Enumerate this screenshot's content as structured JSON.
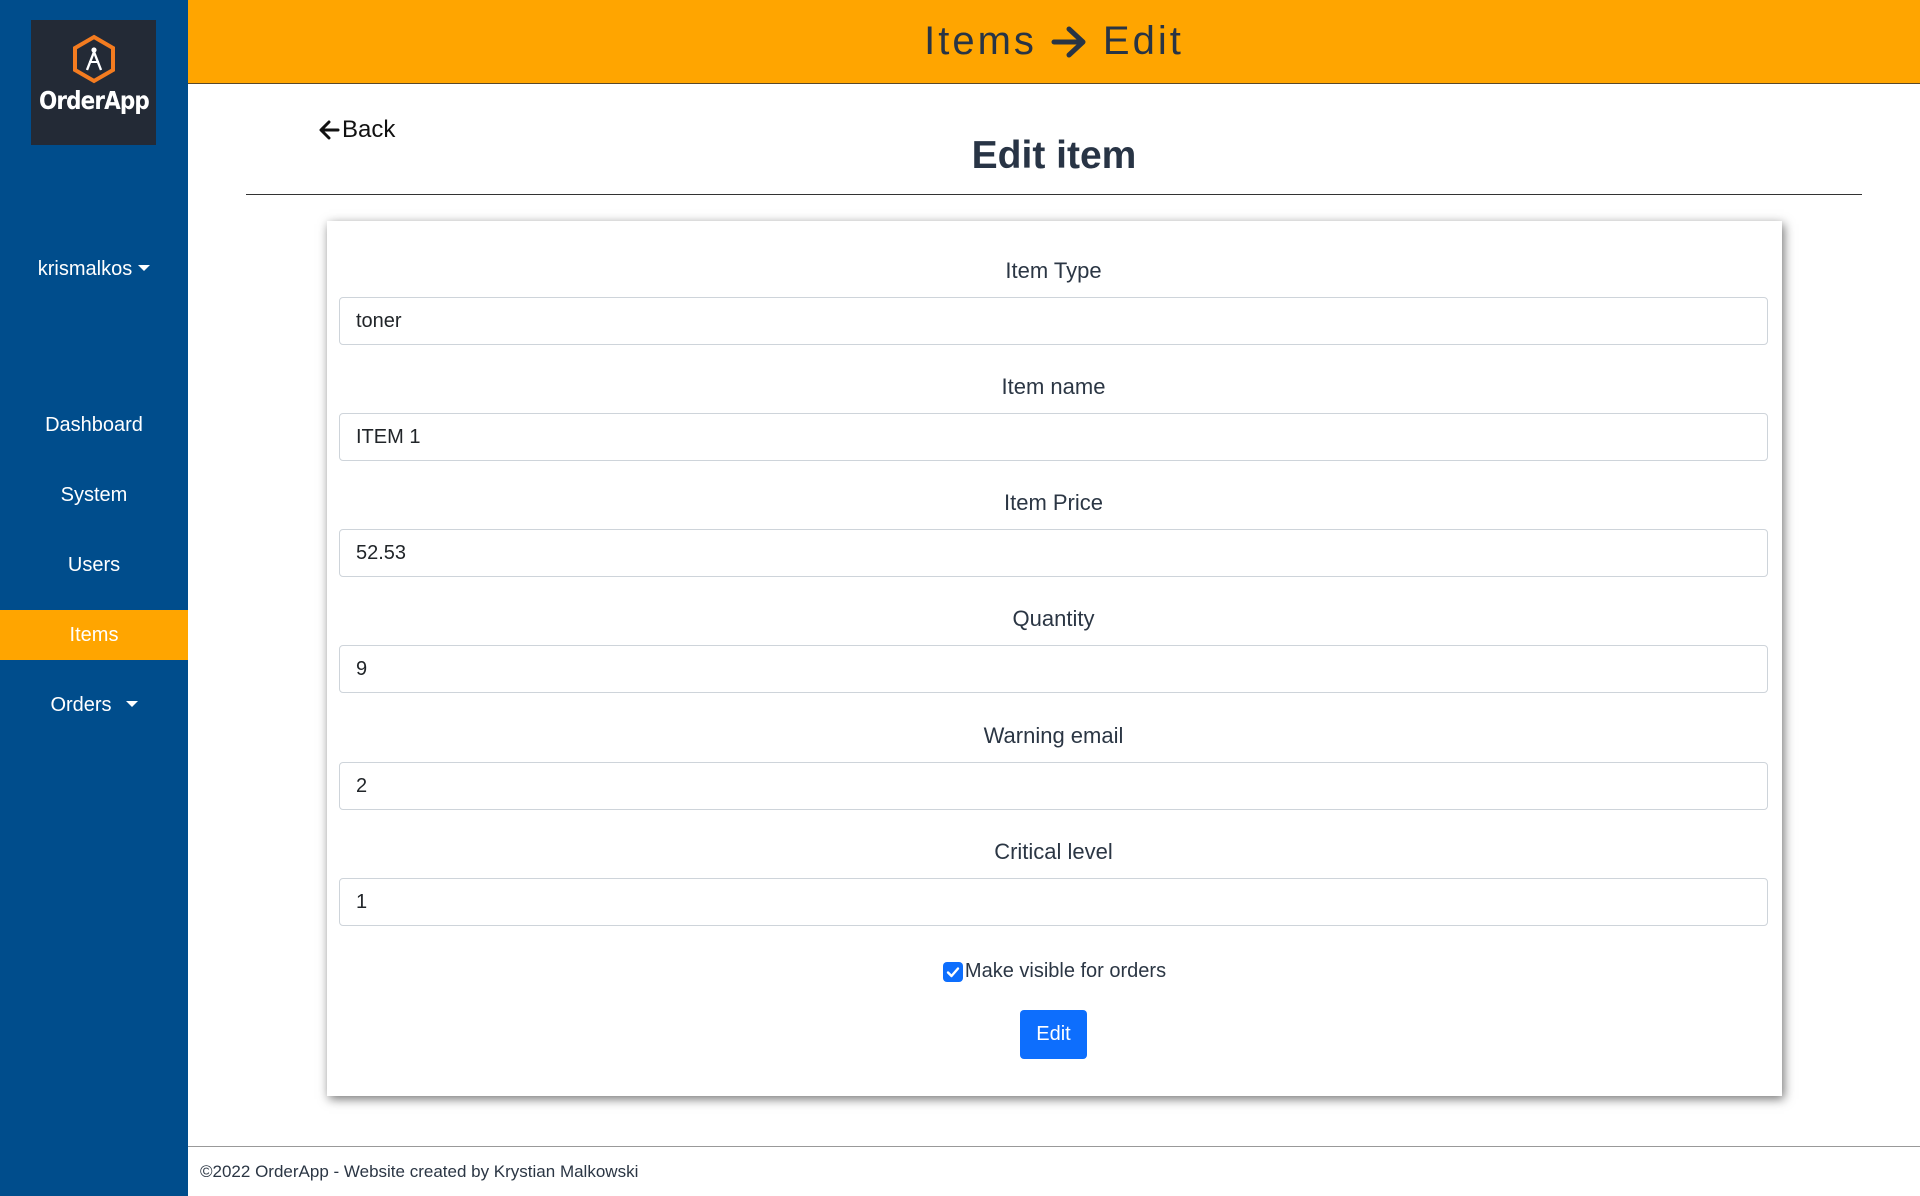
{
  "app": {
    "logo_text": "OrderApp",
    "colors": {
      "sidebar": "#004d8c",
      "accent": "#ffa500",
      "logo_bg": "#232a36",
      "primary": "#0d6efd"
    }
  },
  "header": {
    "crumb_parent": "Items",
    "crumb_separator_icon": "arrow-right-icon",
    "crumb_current": "Edit"
  },
  "sidebar": {
    "user": "krismalkos",
    "items": [
      {
        "label": "Dashboard",
        "active": false
      },
      {
        "label": "System",
        "active": false
      },
      {
        "label": "Users",
        "active": false
      },
      {
        "label": "Items",
        "active": true
      },
      {
        "label": "Orders",
        "active": false,
        "dropdown": true
      }
    ]
  },
  "page": {
    "back_label": "Back",
    "title": "Edit item"
  },
  "form": {
    "fields": [
      {
        "label": "Item Type",
        "value": "toner"
      },
      {
        "label": "Item name",
        "value": "ITEM 1"
      },
      {
        "label": "Item Price",
        "value": "52.53"
      },
      {
        "label": "Quantity",
        "value": "9"
      },
      {
        "label": "Warning email",
        "value": "2"
      },
      {
        "label": "Critical level",
        "value": "1"
      }
    ],
    "visible_checkbox": {
      "label": "Make visible for orders",
      "checked": true
    },
    "submit_label": "Edit"
  },
  "footer": {
    "text": "©2022 OrderApp - Website created by Krystian Malkowski"
  }
}
